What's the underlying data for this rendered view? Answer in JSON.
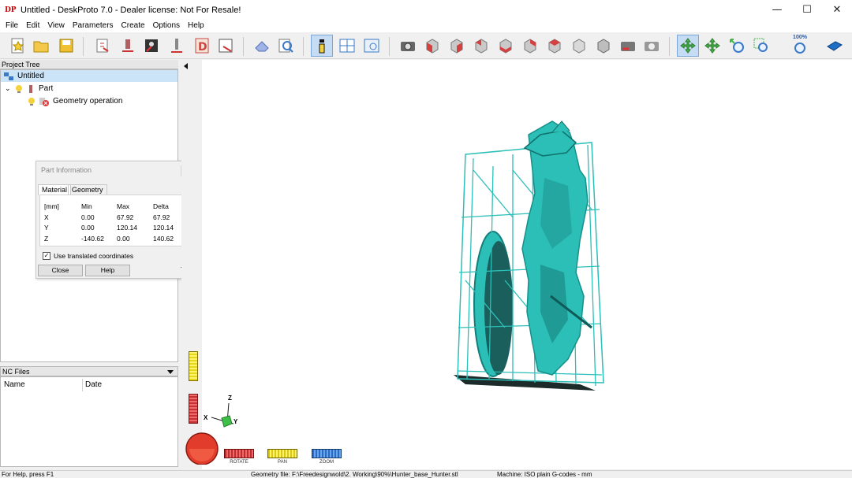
{
  "window": {
    "logo_text": "DP",
    "title": "Untitled - DeskProto 7.0 - Dealer license: Not For Resale!",
    "minimize_glyph": "—",
    "maximize_glyph": "☐",
    "close_glyph": "✕"
  },
  "menu": [
    "File",
    "Edit",
    "View",
    "Parameters",
    "Create",
    "Options",
    "Help"
  ],
  "toolbar": {
    "zoom_100_label": "100%"
  },
  "project_tree": {
    "header": "Project Tree",
    "root_label": "Untitled",
    "part_label": "Part",
    "geometry_label": "Geometry operation",
    "expander": "⌄"
  },
  "nc_files": {
    "header": "NC Files",
    "col_name": "Name",
    "col_date": "Date"
  },
  "part_info": {
    "title": "Part Information",
    "tabs": [
      "Material",
      "Geometry"
    ],
    "headers": [
      "[mm]",
      "Min",
      "Max",
      "Delta"
    ],
    "rows": [
      [
        "X",
        "0.00",
        "67.92",
        "67.92"
      ],
      [
        "Y",
        "0.00",
        "120.14",
        "120.14"
      ],
      [
        "Z",
        "-140.62",
        "0.00",
        "140.62"
      ]
    ],
    "checkbox_label": "Use translated coordinates",
    "checkbox_checked": true,
    "close_label": "Close",
    "help_label": "Help"
  },
  "viewport": {
    "axis_x": "X",
    "axis_y": "Y",
    "axis_z": "Z",
    "rotate_label": "ROTATE",
    "pan_label": "PAN",
    "zoom_label": "ZOOM",
    "model_color": "#2bbfb8"
  },
  "status": {
    "help": "For Help, press F1",
    "geometry_file": "Geometry file: F:\\Freedesignwold\\2. Working\\90%\\Hunter_base_Hunter.stl",
    "machine": "Machine: ISO plain G-codes - mm"
  }
}
